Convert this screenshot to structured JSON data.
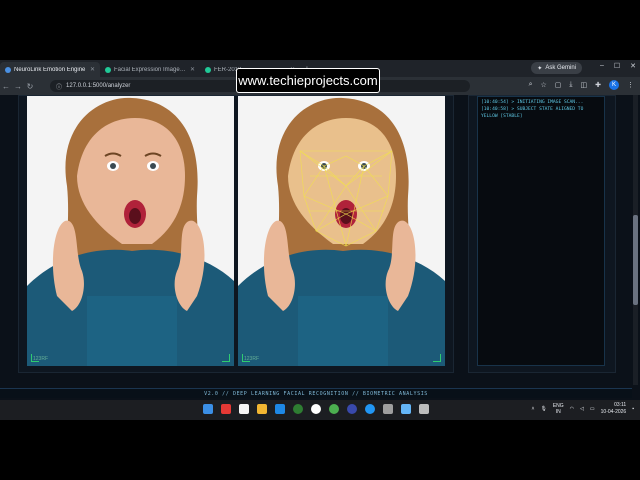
{
  "browser": {
    "tabs": [
      {
        "label": "NeuroLink Emotion Engine",
        "favicon_color": "#4a90e2",
        "active": true
      },
      {
        "label": "Facial Expression Image Data A",
        "favicon_color": "#20c997",
        "active": false
      },
      {
        "label": "FER-2013",
        "favicon_color": "#20c997",
        "active": false
      }
    ],
    "new_tab_label": "+",
    "gemini_label": "Ask Gemini",
    "window_controls": {
      "minimize": "–",
      "maximize": "☐",
      "close": "✕"
    },
    "url": "127.0.0.1:5000/analyzer",
    "avatar_letter": "K"
  },
  "watermark": "www.techieprojects.com",
  "analyzer": {
    "image_tag_left": "123RF",
    "image_tag_right": "123RF",
    "log_lines": [
      "[10:40:54] > INITIATING IMAGE SCAN...",
      "[10:40:58] > SUBJECT STATE ALIGNED TO",
      "YELLOW [STABLE]"
    ],
    "footer": "V2.0 // DEEP LEARNING FACIAL RECOGNITION // BIOMETRIC ANALYSIS"
  },
  "taskbar": {
    "lang_top": "ENG",
    "lang_bottom": "IN",
    "time": "03:11",
    "date": "10-04-2026",
    "app_colors": [
      "#3b8fe6",
      "#e53935",
      "#f5f5f5",
      "#f2b632",
      "#1e88e5",
      "#2e7d32",
      "#ffffff",
      "#4caf50",
      "#3949ab",
      "#2196f3",
      "#9e9e9e",
      "#64b5f6",
      "#bdbdbd"
    ]
  },
  "colors": {
    "accent_green": "#2ecc71",
    "log_cyan": "#5fc9e6",
    "mesh_yellow": "#f2e14c"
  }
}
